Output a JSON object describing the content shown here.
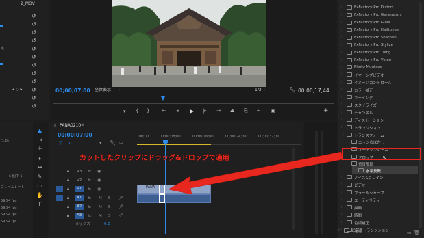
{
  "project_panel": {
    "title": "2_MOV",
    "row_labels": [
      "定",
      "(1.0)",
      "$ 個中 1",
      "フレームレート",
      "59.94 fps",
      "59.94 fps",
      "59.94 fps",
      "59.94 fps"
    ]
  },
  "program_monitor": {
    "timecode_current": "00;00;07;00",
    "fit_label": "全体表示",
    "resolution": "1/2",
    "timecode_duration": "00;00;17;44"
  },
  "timeline": {
    "sequence_name": "PANA0210",
    "timecode": "00;00;07;00",
    "ruler_ticks": [
      ":00;00",
      "00;00;08;00",
      "00;00;16;00",
      "00;00;24;00",
      "00;00;32;00"
    ],
    "video_tracks": [
      "V3",
      "V2",
      "V1"
    ],
    "audio_tracks": [
      "A1",
      "A2",
      "A3"
    ],
    "clip_label": "PANA",
    "mix_label": "ミックス",
    "mix_value": "0.0"
  },
  "annotation": {
    "text": "カットしたクリップにドラッグ&ドロップで適用",
    "color": "#e8281e"
  },
  "effects_panel": {
    "items": [
      {
        "label": "FxFactory Pro Distort",
        "indent": 0
      },
      {
        "label": "FxFactory Pro Generators",
        "indent": 0
      },
      {
        "label": "FxFactory Pro Glow",
        "indent": 0
      },
      {
        "label": "FxFactory Pro Halftones",
        "indent": 0
      },
      {
        "label": "FxFactory Pro Sharpen",
        "indent": 0
      },
      {
        "label": "FxFactory Pro Stylize",
        "indent": 0
      },
      {
        "label": "FxFactory Pro Tiling",
        "indent": 0
      },
      {
        "label": "FxFactory Pro Video",
        "indent": 0
      },
      {
        "label": "Photo Montage",
        "indent": 0
      },
      {
        "label": "イマーシブビデオ",
        "indent": 0
      },
      {
        "label": "イメージコントロール",
        "indent": 0
      },
      {
        "label": "カラー補正",
        "indent": 0
      },
      {
        "label": "キーイング",
        "indent": 0
      },
      {
        "label": "スタイライズ",
        "indent": 0
      },
      {
        "label": "チャンネル",
        "indent": 0
      },
      {
        "label": "ディストーション",
        "indent": 0
      },
      {
        "label": "トランジション",
        "indent": 0
      },
      {
        "label": "トランスフォーム",
        "indent": 0,
        "open": true
      },
      {
        "label": "エッジのぼかし",
        "indent": 1
      },
      {
        "label": "オートリフレーム",
        "indent": 1
      },
      {
        "label": "クロップ",
        "indent": 1
      },
      {
        "label": "垂直反転",
        "indent": 1
      },
      {
        "label": "水平反転",
        "indent": 1,
        "selected": true
      },
      {
        "label": "ノイズ&グレイン",
        "indent": 0
      },
      {
        "label": "ビデオ",
        "indent": 0
      },
      {
        "label": "ブラー＆シャープ",
        "indent": 0
      },
      {
        "label": "ユーティリティ",
        "indent": 0
      },
      {
        "label": "描画",
        "indent": 0
      },
      {
        "label": "時間",
        "indent": 0
      },
      {
        "label": "色調補正",
        "indent": 0
      },
      {
        "label": "遠近",
        "indent": 0
      },
      {
        "label": "ビデオトランジション",
        "indent": -1
      }
    ]
  }
}
